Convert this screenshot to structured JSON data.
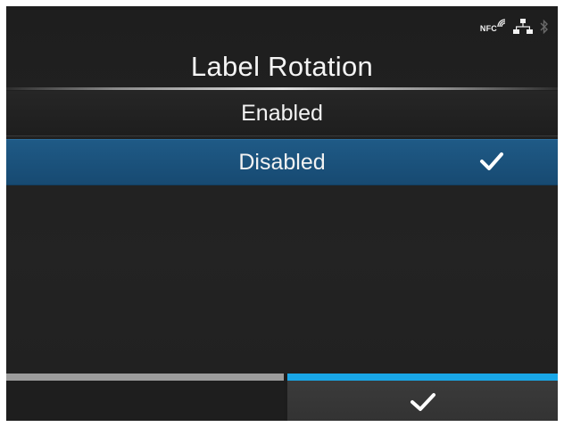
{
  "status_bar": {
    "nfc_label": "NFC",
    "icons": [
      "nfc-icon",
      "network-icon",
      "bluetooth-icon"
    ]
  },
  "title": "Label Rotation",
  "options": [
    {
      "label": "Enabled",
      "selected": false
    },
    {
      "label": "Disabled",
      "selected": true
    }
  ],
  "softkeys": {
    "left": {
      "icon": "none"
    },
    "right": {
      "icon": "checkmark-icon"
    }
  },
  "colors": {
    "background": "#202020",
    "selected_row": "#1b5380",
    "accent_strip": "#19a7e8",
    "inactive_strip": "#9c9c9c",
    "text": "#f2f2f2"
  }
}
